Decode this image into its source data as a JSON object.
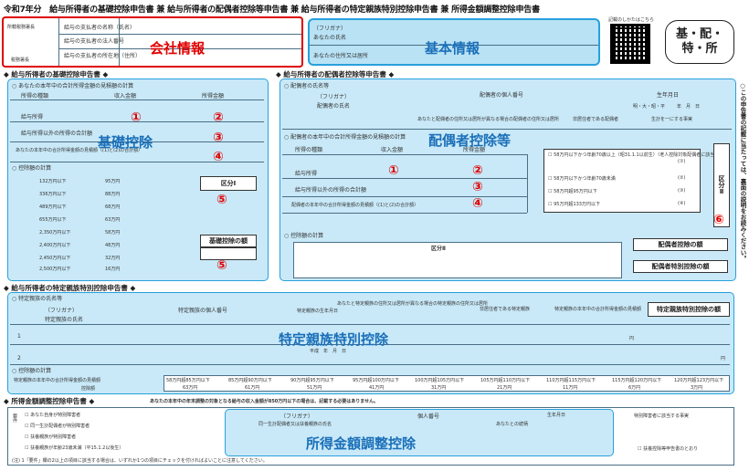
{
  "header": {
    "title": "令和7年分　給与所得者の基礎控除申告書 兼 給与所得者の配偶者控除等申告書 兼 給与所得者の特定親族特別控除申告書 兼 所得金額調整控除申告書",
    "qr_caption": "記載のしかたはこちら",
    "badge_line1": "基・配・",
    "badge_line2": "特・所"
  },
  "employer_box": {
    "row_labels": [
      "所轄税務署長",
      "給与の支払者の名称（氏名）",
      "給与の支払者の法人番号",
      "給与の支払者の所在地（住所）"
    ],
    "tax_office": "税務署長",
    "label": "会社情報"
  },
  "basic_info_box": {
    "furigana": "（フリガナ）",
    "name_label": "あなたの氏名",
    "address_label": "あなたの住所又は居所",
    "label": "基本情報"
  },
  "sections": {
    "basic_deduction": "◆ 給与所得者の基礎控除申告書 ◆",
    "spouse_deduction": "◆ 給与所得者の配偶者控除等申告書 ◆",
    "specific_relative": "◆ 給与所得者の特定親族特別控除申告書 ◆",
    "income_adjustment": "◆ 所得金額調整控除申告書 ◆",
    "income_adjustment_note": "あなたの本年中の年末調整の対象となる給与の収入金額が850万円以下の場合は、記載する必要はありません。"
  },
  "basic_box": {
    "sub1": "○ あなたの本年中の合計所得金額の見積額の計算",
    "col_headers": [
      "所得の種類",
      "収入金額",
      "所得金額"
    ],
    "rows": [
      "給与所得",
      "給与所得以外の所得の合計額"
    ],
    "total_row": "あなたの本年中の合計所得金額の見積額（(1)と(2)の合計額）",
    "sub2": "○ 控除額の計算",
    "kubun1": "区分Ⅰ",
    "deduction_amount": "基礎控除の額",
    "deduction_rows": [
      "132万円以下",
      "336万円以下",
      "489万円以下",
      "655万円以下",
      "2,350万円以下",
      "2,400万円以下",
      "2,450万円以下",
      "2,500万円以下"
    ],
    "deduction_vals": [
      "95万円",
      "88万円",
      "68万円",
      "63万円",
      "58万円",
      "48万円",
      "32万円",
      "16万円"
    ],
    "label": "基礎控除",
    "markers": [
      "①",
      "②",
      "③",
      "④",
      "⑤",
      "⑤"
    ]
  },
  "spouse_box": {
    "sub1": "○ 配偶者の氏名等",
    "furigana": "（フリガナ）",
    "spouse_name": "配偶者の氏名",
    "my_number": "配偶者の個人番号",
    "birthdate": "生年月日",
    "era": "明・大・昭・平",
    "ymd": "年　月　日",
    "address": "あなたと配偶者の住所又は居所が異なる場合の配偶者の住所又は居所",
    "non_resident": "非居住者である配偶者",
    "same_livelihood": "生計を一にする事実",
    "sub2": "○ 配偶者の本年中の合計所得金額の見積額の計算",
    "col_headers": [
      "所得の種類",
      "収入金額",
      "所得金額"
    ],
    "rows": [
      "給与所得",
      "給与所得以外の所得の合計額"
    ],
    "total_row": "配偶者の本年中の合計所得金額の見積額（(1)と(2)の合計額）",
    "checks": [
      "58万円以下かつ年齢70歳以上（昭31.1.1以前生）（老人控除対象配偶者に該当）",
      "58万円以下かつ年齢70歳未満",
      "58万円超95万円以下",
      "95万円超133万円以下"
    ],
    "check_codes": [
      "(①)",
      "(②)",
      "(③)",
      "(④)"
    ],
    "kubun2": "区分Ⅱ",
    "sub3": "○ 控除額の計算",
    "calc_header": "区分Ⅱ",
    "spouse_deduction_amount": "配偶者控除の額",
    "spouse_special_amount": "配偶者特別控除の額",
    "label": "配偶者控除等",
    "markers": [
      "①",
      "②",
      "③",
      "④",
      "⑥"
    ]
  },
  "specific_box": {
    "sub1": "○ 特定親族の氏名等",
    "furigana": "（フリガナ）",
    "name": "特定親族の氏名",
    "my_number": "特定親族の個人番号",
    "relation": "あなたとの続柄",
    "birthdate": "特定親族の生年月日",
    "address": "あなたと特定親族の住所又は居所が異なる場合の特定親族の住所又は居所",
    "non_resident": "非居住者である特定親族",
    "income": "特定親族の本年中の合計所得金額の見積額",
    "deduction_hdr": "特定親族特別控除の額",
    "row_nums": [
      "1",
      "2"
    ],
    "heisei": "平成　年　月　日",
    "yen": "円",
    "sub2": "○ 控除額の計算",
    "calc_rows": [
      "58万円超85万円以下",
      "85万円超90万円以下",
      "90万円超95万円以下",
      "95万円超100万円以下",
      "100万円超105万円以下",
      "105万円超110万円以下",
      "110万円超115万円以下",
      "115万円超120万円以下",
      "120万円超123万円以下"
    ],
    "calc_vals": [
      "63万円",
      "61万円",
      "51万円",
      "41万円",
      "31万円",
      "21万円",
      "11万円",
      "6万円",
      "3万円"
    ],
    "calc_label1": "特定親族の本年中の合計所得金額の見積額",
    "calc_label2": "控除額",
    "label": "特定親族特別控除"
  },
  "adjust_box": {
    "req_label": "要件",
    "checks": [
      "あなた自身が特別障害者",
      "同一生計配偶者が特別障害者",
      "扶養親族が特別障害者",
      "扶養親族が年齢23歳未満（平15.1.2以後生）"
    ],
    "furigana": "（フリガナ）",
    "name": "同一生計配偶者又は扶養親族の氏名",
    "my_number": "個人番号",
    "relation": "あなたとの続柄",
    "birthdate": "生年月日",
    "special_disabled": "特別障害者に該当する事実",
    "note": "(注) 1「要件」欄の2以上の項目に該当する場合は、いずれか1つの項目にチェックを付ければよいことに注意してください。",
    "certificate": "扶養控除等申告書のとおり",
    "label": "所得金額調整控除"
  },
  "side_note": "○この申告書の記載に当たっては、裏面の説明をお読みください。"
}
